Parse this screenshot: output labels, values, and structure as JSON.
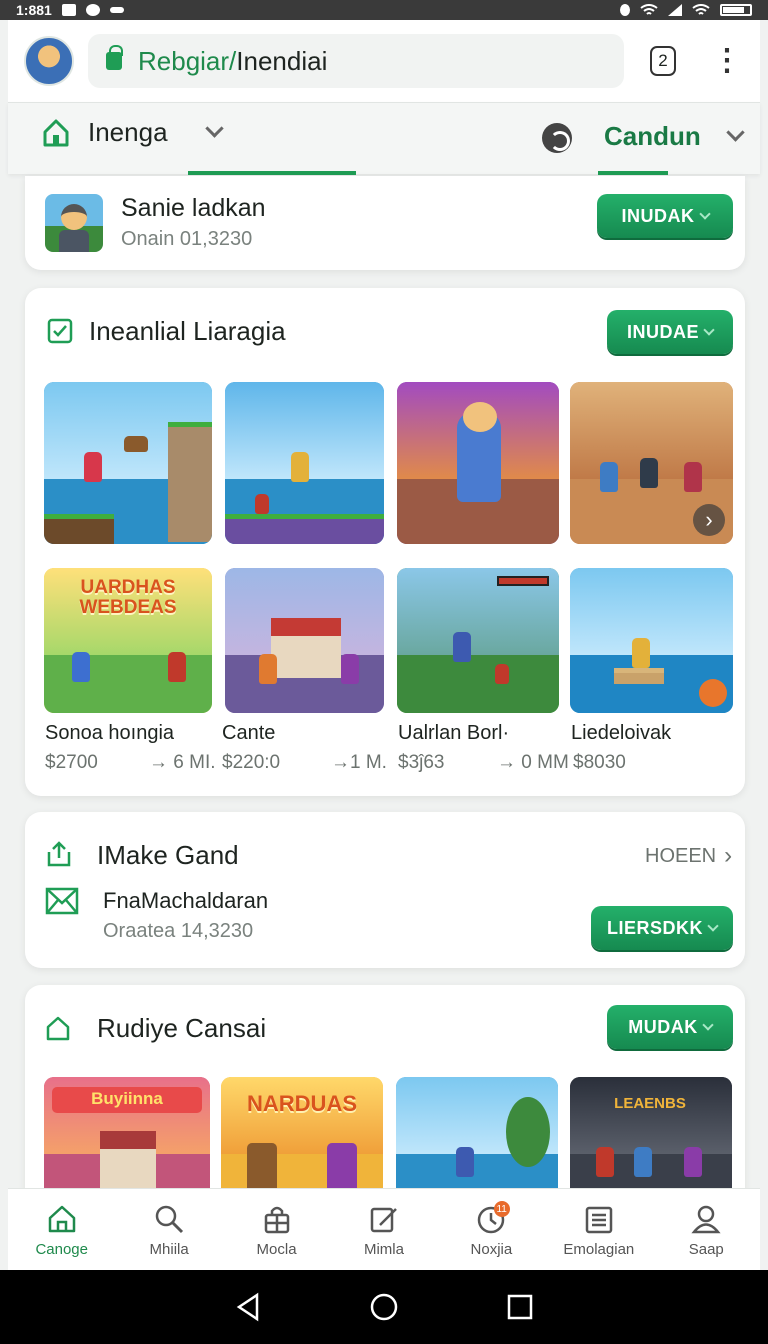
{
  "status_bar": {
    "time": "1:881"
  },
  "browser": {
    "url_green": "Rebgiar/",
    "url_dark": "Inendiai",
    "tab_count": "2"
  },
  "tab_bar": {
    "left_label": "Inenga",
    "right_label": "Candun"
  },
  "profile_card": {
    "name": "Sanie ladkan",
    "subtitle": "Onain 01,3230",
    "button": "INUDAK"
  },
  "games_card": {
    "title": "Ineanlial Liaragia",
    "button": "INUDAE",
    "items": [
      {
        "name": "Sonoa hoıngia",
        "price": "$2700",
        "meta": "→ 6 MI."
      },
      {
        "name": "Cante",
        "price": "$220:0",
        "meta": "→1 M."
      },
      {
        "name": "Ualrlan Borl·",
        "price": "$3ĵ63",
        "meta": "→ 0 MM"
      },
      {
        "name": "Liedeloivak",
        "price": "$8030",
        "meta": ""
      }
    ],
    "banner_text": "UARDHAS WEBDEAS"
  },
  "make_card": {
    "title": "IMake Gand",
    "link": "HOEEN",
    "item_name": "FnaMachaldaran",
    "item_sub": "Oraatea 14,3230",
    "button": "LIERSDKK"
  },
  "rudiye_card": {
    "title": "Rudiye Cansai",
    "button": "MUDAK",
    "thumb_labels": [
      "Buyiinna",
      "NARDUAS",
      "",
      "LEAENBS"
    ]
  },
  "bottom_nav": [
    {
      "label": "Canoge",
      "icon": "home-icon"
    },
    {
      "label": "Mhiila",
      "icon": "search-icon"
    },
    {
      "label": "Mocla",
      "icon": "bag-icon"
    },
    {
      "label": "Mimla",
      "icon": "edit-icon"
    },
    {
      "label": "Noxjia",
      "icon": "clock-icon",
      "badge": "11"
    },
    {
      "label": "Emolagian",
      "icon": "list-icon"
    },
    {
      "label": "Saap",
      "icon": "user-icon"
    }
  ],
  "colors": {
    "accent": "#1f9d55",
    "accent_dark": "#168a50",
    "text": "#1e2420"
  }
}
